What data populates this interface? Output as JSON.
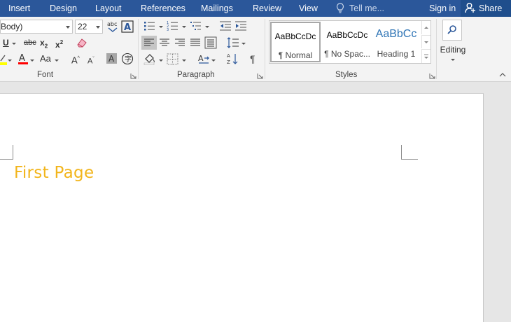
{
  "tabs": [
    "Insert",
    "Design",
    "Layout",
    "References",
    "Mailings",
    "Review",
    "View"
  ],
  "tell_me": "Tell me...",
  "sign_in": "Sign in",
  "share": "Share",
  "font": {
    "name": "Body)",
    "size": "22",
    "group_label": "Font"
  },
  "paragraph": {
    "group_label": "Paragraph"
  },
  "styles": {
    "group_label": "Styles",
    "items": [
      {
        "preview": "AaBbCcDc",
        "name": "¶ Normal"
      },
      {
        "preview": "AaBbCcDc",
        "name": "¶ No Spac..."
      },
      {
        "preview": "AaBbCc",
        "name": "Heading 1"
      }
    ]
  },
  "editing": {
    "label": "Editing"
  },
  "document": {
    "heading": "First Page",
    "heading_color": "#f2b51c"
  },
  "colors": {
    "ribbon_tab_bg": "#2b579a",
    "ribbon_bg": "#f3f3f3",
    "canvas_bg": "#e6e6e6"
  }
}
